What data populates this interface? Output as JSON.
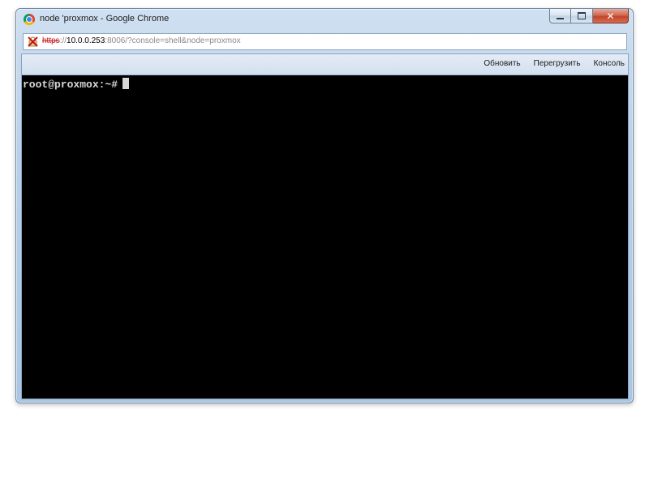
{
  "window": {
    "title": "node 'proxmox - Google Chrome",
    "buttons": {
      "minimize": "–",
      "maximize": "□",
      "close": "✕"
    }
  },
  "addressbar": {
    "scheme": "https",
    "scheme_suffix": "://",
    "host": "10.0.0.253",
    "rest": ":8006/?console=shell&node=proxmox",
    "security_icon": "insecure-https-icon"
  },
  "toolbar": {
    "items": [
      "Обновить",
      "Перегрузить",
      "Консоль"
    ]
  },
  "terminal": {
    "prompt": "root@proxmox:~#"
  },
  "colors": {
    "terminal_bg": "#000000",
    "terminal_fg": "#d8d8d8",
    "insecure_red": "#c4141b"
  }
}
